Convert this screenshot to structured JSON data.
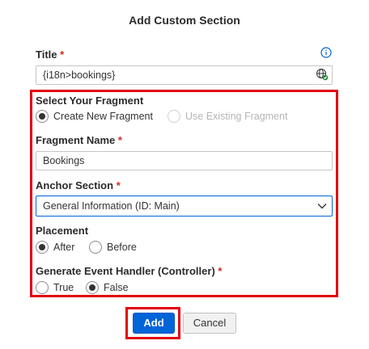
{
  "dialog": {
    "title": "Add Custom Section"
  },
  "title_field": {
    "label": "Title",
    "required_mark": "*",
    "value": "{i18n>bookings}"
  },
  "fragment": {
    "label": "Select Your Fragment",
    "options": [
      {
        "label": "Create New Fragment",
        "selected": true,
        "disabled": false
      },
      {
        "label": "Use Existing Fragment",
        "selected": false,
        "disabled": true
      }
    ]
  },
  "fragment_name": {
    "label": "Fragment Name",
    "required_mark": "*",
    "value": "Bookings"
  },
  "anchor_section": {
    "label": "Anchor Section",
    "required_mark": "*",
    "selected": "General Information (ID: Main)"
  },
  "placement": {
    "label": "Placement",
    "options": [
      {
        "label": "After",
        "selected": true
      },
      {
        "label": "Before",
        "selected": false
      }
    ]
  },
  "event_handler": {
    "label": "Generate Event Handler (Controller)",
    "required_mark": "*",
    "options": [
      {
        "label": "True",
        "selected": false
      },
      {
        "label": "False",
        "selected": true
      }
    ]
  },
  "buttons": {
    "add": "Add",
    "cancel": "Cancel"
  },
  "colors": {
    "accent": "#0064d9",
    "highlight": "#e3000f",
    "required": "#cc2b1f"
  }
}
